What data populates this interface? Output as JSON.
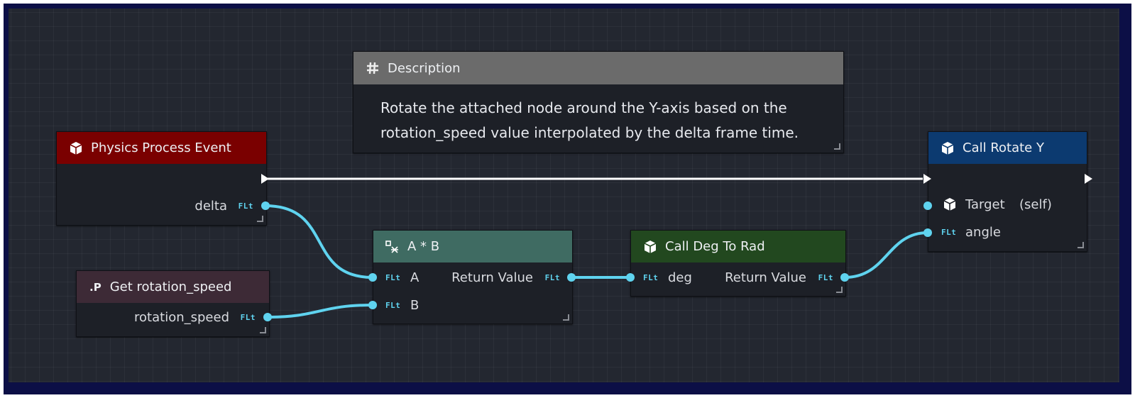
{
  "comment": {
    "title": "Description",
    "text": "Rotate the attached node around the Y-axis based on the rotation_speed value interpolated by the delta frame time.",
    "header_color": "#6b6b6b"
  },
  "physics_node": {
    "title": "Physics Process Event",
    "header_color": "#7a0000",
    "output_label": "delta",
    "output_type": "FLt"
  },
  "get_node": {
    "title": "Get rotation_speed",
    "icon_text": ".P",
    "header_color": "#3d2a36",
    "output_label": "rotation_speed",
    "output_type": "FLt"
  },
  "multiply_node": {
    "title": "A * B",
    "header_color": "#3f6b62",
    "input_a_label": "A",
    "input_b_label": "B",
    "input_type": "FLt",
    "output_label": "Return Value",
    "output_type": "FLt"
  },
  "deg_node": {
    "title": "Call Deg To Rad",
    "header_color": "#22481f",
    "input_label": "deg",
    "input_type": "FLt",
    "output_label": "Return Value",
    "output_type": "FLt"
  },
  "rotate_node": {
    "title": "Call Rotate Y",
    "header_color": "#0c3a70",
    "target_label": "Target",
    "target_value": "(self)",
    "angle_label": "angle",
    "angle_type": "FLt"
  },
  "colors": {
    "float_wire": "#5fd3ef",
    "exec_wire": "#ffffff",
    "canvas_bg": "#232730",
    "frame_border": "#0c0f46"
  }
}
